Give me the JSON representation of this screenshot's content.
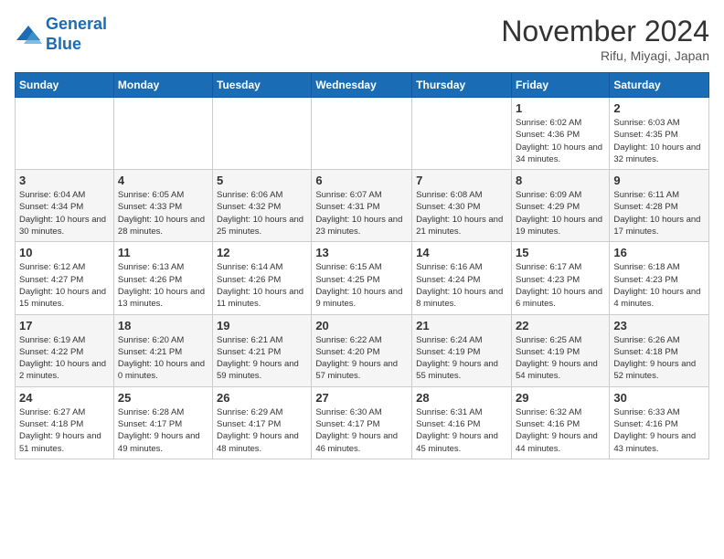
{
  "logo": {
    "line1": "General",
    "line2": "Blue"
  },
  "title": "November 2024",
  "location": "Rifu, Miyagi, Japan",
  "weekdays": [
    "Sunday",
    "Monday",
    "Tuesday",
    "Wednesday",
    "Thursday",
    "Friday",
    "Saturday"
  ],
  "weeks": [
    [
      {
        "day": "",
        "info": ""
      },
      {
        "day": "",
        "info": ""
      },
      {
        "day": "",
        "info": ""
      },
      {
        "day": "",
        "info": ""
      },
      {
        "day": "",
        "info": ""
      },
      {
        "day": "1",
        "info": "Sunrise: 6:02 AM\nSunset: 4:36 PM\nDaylight: 10 hours and 34 minutes."
      },
      {
        "day": "2",
        "info": "Sunrise: 6:03 AM\nSunset: 4:35 PM\nDaylight: 10 hours and 32 minutes."
      }
    ],
    [
      {
        "day": "3",
        "info": "Sunrise: 6:04 AM\nSunset: 4:34 PM\nDaylight: 10 hours and 30 minutes."
      },
      {
        "day": "4",
        "info": "Sunrise: 6:05 AM\nSunset: 4:33 PM\nDaylight: 10 hours and 28 minutes."
      },
      {
        "day": "5",
        "info": "Sunrise: 6:06 AM\nSunset: 4:32 PM\nDaylight: 10 hours and 25 minutes."
      },
      {
        "day": "6",
        "info": "Sunrise: 6:07 AM\nSunset: 4:31 PM\nDaylight: 10 hours and 23 minutes."
      },
      {
        "day": "7",
        "info": "Sunrise: 6:08 AM\nSunset: 4:30 PM\nDaylight: 10 hours and 21 minutes."
      },
      {
        "day": "8",
        "info": "Sunrise: 6:09 AM\nSunset: 4:29 PM\nDaylight: 10 hours and 19 minutes."
      },
      {
        "day": "9",
        "info": "Sunrise: 6:11 AM\nSunset: 4:28 PM\nDaylight: 10 hours and 17 minutes."
      }
    ],
    [
      {
        "day": "10",
        "info": "Sunrise: 6:12 AM\nSunset: 4:27 PM\nDaylight: 10 hours and 15 minutes."
      },
      {
        "day": "11",
        "info": "Sunrise: 6:13 AM\nSunset: 4:26 PM\nDaylight: 10 hours and 13 minutes."
      },
      {
        "day": "12",
        "info": "Sunrise: 6:14 AM\nSunset: 4:26 PM\nDaylight: 10 hours and 11 minutes."
      },
      {
        "day": "13",
        "info": "Sunrise: 6:15 AM\nSunset: 4:25 PM\nDaylight: 10 hours and 9 minutes."
      },
      {
        "day": "14",
        "info": "Sunrise: 6:16 AM\nSunset: 4:24 PM\nDaylight: 10 hours and 8 minutes."
      },
      {
        "day": "15",
        "info": "Sunrise: 6:17 AM\nSunset: 4:23 PM\nDaylight: 10 hours and 6 minutes."
      },
      {
        "day": "16",
        "info": "Sunrise: 6:18 AM\nSunset: 4:23 PM\nDaylight: 10 hours and 4 minutes."
      }
    ],
    [
      {
        "day": "17",
        "info": "Sunrise: 6:19 AM\nSunset: 4:22 PM\nDaylight: 10 hours and 2 minutes."
      },
      {
        "day": "18",
        "info": "Sunrise: 6:20 AM\nSunset: 4:21 PM\nDaylight: 10 hours and 0 minutes."
      },
      {
        "day": "19",
        "info": "Sunrise: 6:21 AM\nSunset: 4:21 PM\nDaylight: 9 hours and 59 minutes."
      },
      {
        "day": "20",
        "info": "Sunrise: 6:22 AM\nSunset: 4:20 PM\nDaylight: 9 hours and 57 minutes."
      },
      {
        "day": "21",
        "info": "Sunrise: 6:24 AM\nSunset: 4:19 PM\nDaylight: 9 hours and 55 minutes."
      },
      {
        "day": "22",
        "info": "Sunrise: 6:25 AM\nSunset: 4:19 PM\nDaylight: 9 hours and 54 minutes."
      },
      {
        "day": "23",
        "info": "Sunrise: 6:26 AM\nSunset: 4:18 PM\nDaylight: 9 hours and 52 minutes."
      }
    ],
    [
      {
        "day": "24",
        "info": "Sunrise: 6:27 AM\nSunset: 4:18 PM\nDaylight: 9 hours and 51 minutes."
      },
      {
        "day": "25",
        "info": "Sunrise: 6:28 AM\nSunset: 4:17 PM\nDaylight: 9 hours and 49 minutes."
      },
      {
        "day": "26",
        "info": "Sunrise: 6:29 AM\nSunset: 4:17 PM\nDaylight: 9 hours and 48 minutes."
      },
      {
        "day": "27",
        "info": "Sunrise: 6:30 AM\nSunset: 4:17 PM\nDaylight: 9 hours and 46 minutes."
      },
      {
        "day": "28",
        "info": "Sunrise: 6:31 AM\nSunset: 4:16 PM\nDaylight: 9 hours and 45 minutes."
      },
      {
        "day": "29",
        "info": "Sunrise: 6:32 AM\nSunset: 4:16 PM\nDaylight: 9 hours and 44 minutes."
      },
      {
        "day": "30",
        "info": "Sunrise: 6:33 AM\nSunset: 4:16 PM\nDaylight: 9 hours and 43 minutes."
      }
    ]
  ]
}
